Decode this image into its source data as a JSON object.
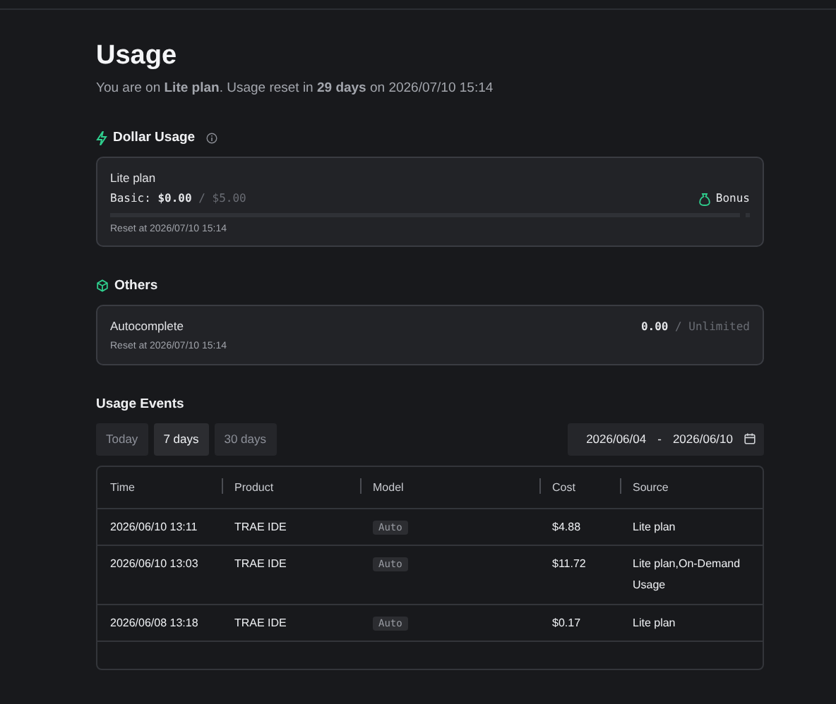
{
  "title": "Usage",
  "subtitle": "You are on **Lite plan**. Usage reset in **29 days** on 2026/07/10 15:14",
  "dollar_usage": {
    "heading": "Dollar Usage",
    "plan": "Lite plan",
    "basic_label": "Basic:",
    "used": "$0.00",
    "separator": "/",
    "limit": "$5.00",
    "bonus": "Bonus",
    "level": 0,
    "reset": "Reset at 2026/07/10 15:14"
  },
  "others": {
    "heading": "Others",
    "name": "Autocomplete",
    "used": "0.00",
    "separator": "/",
    "limit": "Unlimited",
    "reset": "Reset at 2026/07/10 15:14"
  },
  "events": {
    "heading": "Usage Events",
    "ranges": [
      {
        "label": "Today",
        "selected": false
      },
      {
        "label": "7 days",
        "selected": true
      },
      {
        "label": "30 days",
        "selected": false
      }
    ],
    "date_from": "2026/06/04",
    "date_sep": "-",
    "date_to": "2026/06/10",
    "columns": [
      "Time",
      "Product",
      "Model",
      "Cost",
      "Source"
    ],
    "rows": [
      {
        "time": "2026/06/10 13:11",
        "product": "TRAE IDE",
        "model": "Auto",
        "cost": "$4.88",
        "source": "Lite plan"
      },
      {
        "time": "2026/06/10 13:03",
        "product": "TRAE IDE",
        "model": "Auto",
        "cost": "$11.72",
        "source": "Lite plan,On-Demand Usage"
      },
      {
        "time": "2026/06/08 13:18",
        "product": "TRAE IDE",
        "model": "Auto",
        "cost": "$0.17",
        "source": "Lite plan"
      }
    ]
  }
}
